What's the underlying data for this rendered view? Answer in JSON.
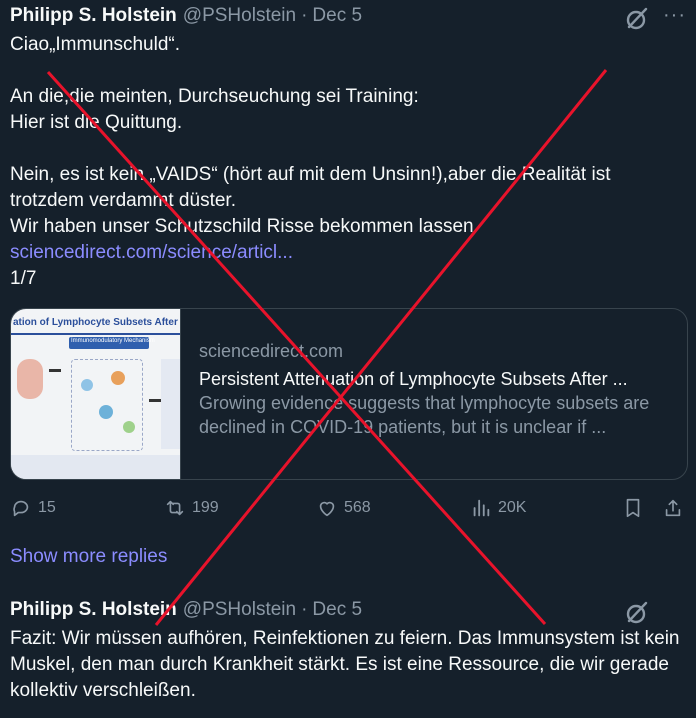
{
  "tweet1": {
    "name": "Philipp S. Holstein",
    "handle": "@PSHolstein",
    "separator": "·",
    "date": "Dec 5",
    "more_label": "···",
    "text_pre": "Ciao„Immunschuld“.\n\nAn die,die meinten, Durchseuchung sei Training:\nHier ist die Quittung.\n\nNein, es ist kein „VAIDS“ (hört auf mit dem Unsinn!),aber die Realität ist trotzdem verdammt düster.\nWir haben unser Schutzschild Risse bekommen lassen ",
    "link": "sciencedirect.com/science/articl...",
    "text_post": "\n1/7"
  },
  "card": {
    "thumb_title": "ation of Lymphocyte Subsets After Mass SARS",
    "thumb_sub": "Immunomodulatory Mechanism",
    "domain": "sciencedirect.com",
    "title": "Persistent Attenuation of Lymphocyte Subsets After ...",
    "description": "Growing evidence suggests that lymphocyte subsets are declined in COVID-19 patients, but it is unclear if ..."
  },
  "actions": {
    "replies": "15",
    "reposts": "199",
    "likes": "568",
    "views": "20K"
  },
  "show_more": "Show more replies",
  "tweet2": {
    "name": "Philipp S. Holstein",
    "handle": "@PSHolstein",
    "separator": "·",
    "date": "Dec 5",
    "text": "Fazit: Wir müssen aufhören, Reinfektionen zu feiern. Das Immunsystem ist kein Muskel, den man durch Krankheit stärkt. Es ist eine Ressource, die wir gerade kollektiv verschleißen."
  },
  "colors": {
    "background": "#15202b",
    "text": "#f7f9f9",
    "muted": "#8b98a5",
    "link": "#8b8cff",
    "cross": "#e8132b"
  },
  "icons": [
    "grok-icon",
    "more-icon",
    "reply-icon",
    "repost-icon",
    "like-icon",
    "views-icon",
    "bookmark-icon",
    "share-icon"
  ]
}
